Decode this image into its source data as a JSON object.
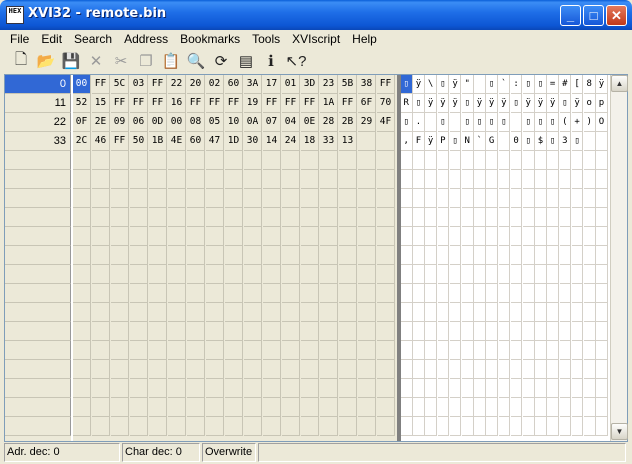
{
  "window": {
    "title": "XVI32 - remote.bin",
    "app_icon_text": "HEX"
  },
  "menu": [
    "File",
    "Edit",
    "Search",
    "Address",
    "Bookmarks",
    "Tools",
    "XVIscript",
    "Help"
  ],
  "toolbar": [
    {
      "name": "new-file-icon",
      "glyph": "🗋",
      "disabled": false
    },
    {
      "name": "open-folder-icon",
      "glyph": "📂",
      "disabled": false
    },
    {
      "name": "save-icon",
      "glyph": "💾",
      "disabled": false
    },
    {
      "name": "delete-icon",
      "glyph": "✕",
      "disabled": true
    },
    {
      "name": "cut-icon",
      "glyph": "✂",
      "disabled": true
    },
    {
      "name": "copy-icon",
      "glyph": "❐",
      "disabled": true
    },
    {
      "name": "paste-icon",
      "glyph": "📋",
      "disabled": false
    },
    {
      "name": "find-icon",
      "glyph": "🔍",
      "disabled": false
    },
    {
      "name": "find-replace-icon",
      "glyph": "⟳",
      "disabled": false
    },
    {
      "name": "properties-icon",
      "glyph": "▤",
      "disabled": false
    },
    {
      "name": "info-icon",
      "glyph": "ℹ",
      "disabled": false
    },
    {
      "name": "help-pointer-icon",
      "glyph": "↖?",
      "disabled": false
    }
  ],
  "addresses": [
    "0",
    "11",
    "22",
    "33"
  ],
  "hex_rows": [
    [
      "00",
      "FF",
      "5C",
      "03",
      "FF",
      "22",
      "20",
      "02",
      "60",
      "3A",
      "17",
      "01",
      "3D",
      "23",
      "5B",
      "38",
      "FF"
    ],
    [
      "52",
      "15",
      "FF",
      "FF",
      "FF",
      "16",
      "FF",
      "FF",
      "FF",
      "19",
      "FF",
      "FF",
      "FF",
      "1A",
      "FF",
      "6F",
      "70"
    ],
    [
      "0F",
      "2E",
      "09",
      "06",
      "0D",
      "00",
      "08",
      "05",
      "10",
      "0A",
      "07",
      "04",
      "0E",
      "28",
      "2B",
      "29",
      "4F"
    ],
    [
      "2C",
      "46",
      "FF",
      "50",
      "1B",
      "4E",
      "60",
      "47",
      "1D",
      "30",
      "14",
      "24",
      "18",
      "33",
      "13",
      "",
      ""
    ]
  ],
  "char_rows": [
    [
      "▯",
      "ÿ",
      "\\",
      "▯",
      "ÿ",
      "\"",
      "",
      "▯",
      "`",
      ":",
      "▯",
      "▯",
      "=",
      "#",
      "[",
      "8",
      "ÿ"
    ],
    [
      "R",
      "▯",
      "ÿ",
      "ÿ",
      "ÿ",
      "▯",
      "ÿ",
      "ÿ",
      "ÿ",
      "▯",
      "ÿ",
      "ÿ",
      "ÿ",
      "▯",
      "ÿ",
      "o",
      "p"
    ],
    [
      "▯",
      ".",
      "",
      "▯",
      "",
      "▯",
      "▯",
      "▯",
      "▯",
      "",
      "▯",
      "▯",
      "▯",
      "(",
      "+",
      ")",
      "O"
    ],
    [
      ",",
      "F",
      "ÿ",
      "P",
      "▯",
      "N",
      "`",
      "G",
      "",
      "0",
      "▯",
      "$",
      "▯",
      "3",
      "▯",
      "",
      ""
    ]
  ],
  "status": {
    "adr": "Adr. dec: 0",
    "char": "Char dec: 0",
    "mode": "Overwrite"
  }
}
